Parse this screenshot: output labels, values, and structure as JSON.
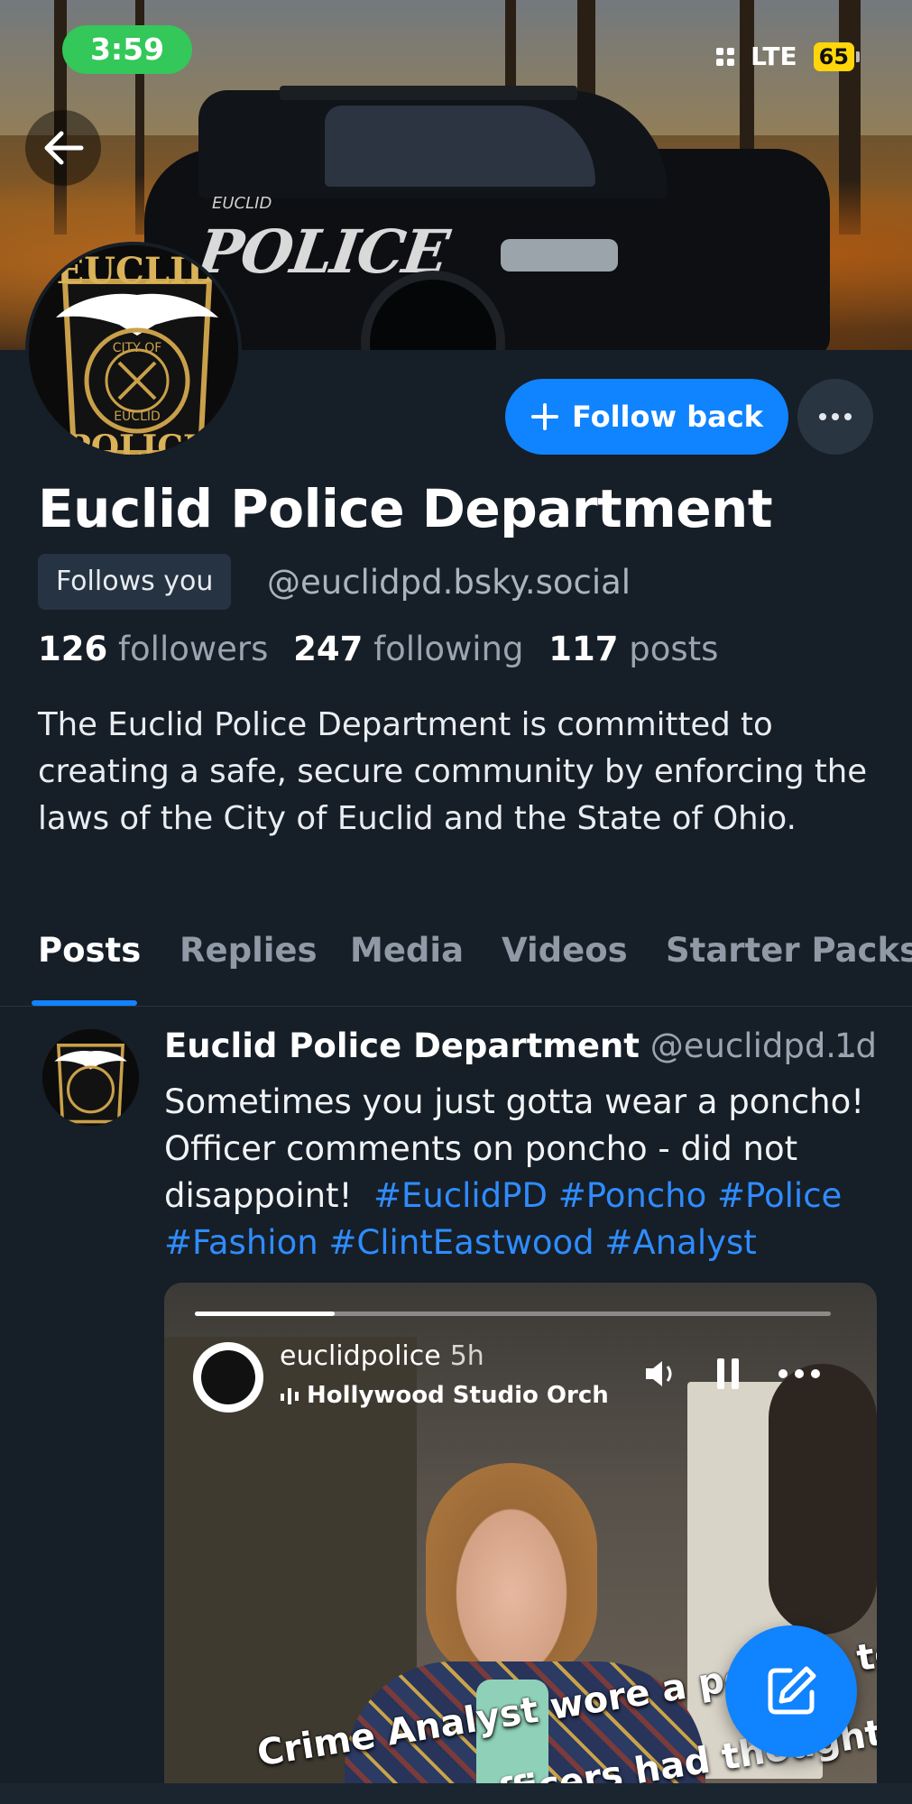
{
  "status_bar": {
    "time": "3:59",
    "network": "LTE",
    "battery": "65"
  },
  "banner": {
    "car_wordmark": "POLICE",
    "car_city": "EUCLID"
  },
  "avatar": {
    "badge_top": "EUCLID",
    "badge_ring": "CITY OF EUCLID",
    "badge_bottom": "POLICE"
  },
  "actions": {
    "follow_back_label": "Follow back"
  },
  "profile": {
    "display_name": "Euclid Police Department",
    "follows_you_label": "Follows you",
    "handle": "@euclidpd.bsky.social",
    "followers_count": "126",
    "followers_label": "followers",
    "following_count": "247",
    "following_label": "following",
    "posts_count": "117",
    "posts_label": "posts",
    "bio": "The Euclid Police Department is committed to creating a safe, secure community by enforcing the laws of the City of Euclid and the State of Ohio."
  },
  "tabs": [
    {
      "label": "Posts",
      "active": true
    },
    {
      "label": "Replies",
      "active": false
    },
    {
      "label": "Media",
      "active": false
    },
    {
      "label": "Videos",
      "active": false
    },
    {
      "label": "Starter Packs",
      "active": false
    }
  ],
  "post": {
    "author_name": "Euclid Police Department",
    "author_handle": "@euclidpd...",
    "time": "· 1d",
    "text": "Sometimes you just gotta wear a poncho! Officer comments on poncho - did not disappoint!",
    "hashtags": [
      "#EuclidPD",
      "#Poncho",
      "#Police",
      "#Fashion",
      "#ClintEastwood",
      "#Analyst"
    ],
    "video": {
      "progress": 0.22,
      "username": "euclidpolice",
      "time_ago": "5h",
      "music": "Hollywood Studio Orch",
      "caption_line1": "Crime Analyst wore a poncho to",
      "caption_line2": "officers had thoughts!"
    }
  },
  "colors": {
    "background": "#161e27",
    "accent": "#1083fe",
    "hashtag": "#2f8cff",
    "status_time_pill": "#34c759",
    "battery": "#ffd60a"
  },
  "icons": [
    "arrow-left-icon",
    "plus-icon",
    "more-horizontal-icon",
    "speaker-icon",
    "pause-icon",
    "compose-icon"
  ]
}
